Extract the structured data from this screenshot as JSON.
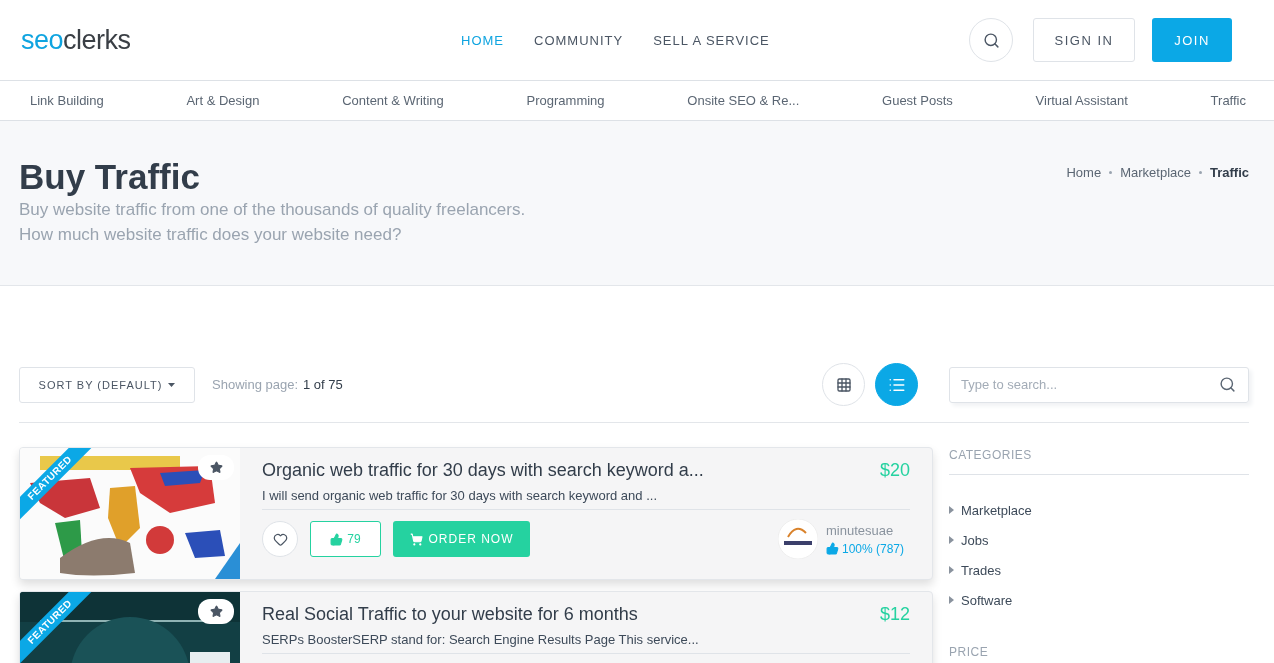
{
  "header": {
    "logo": {
      "part_1": "seo",
      "part_2": "clerks"
    },
    "nav": [
      {
        "label": "HOME",
        "selected": true
      },
      {
        "label": "COMMUNITY",
        "selected": false
      },
      {
        "label": "SELL A SERVICE",
        "selected": false
      }
    ],
    "sign_in": "SIGN IN",
    "join": "JOIN"
  },
  "category_bar": [
    "Link Building",
    "Art & Design",
    "Content & Writing",
    "Programming",
    "Onsite SEO & Re...",
    "Guest Posts",
    "Virtual Assistant",
    "Traffic"
  ],
  "hero": {
    "title": "Buy Traffic",
    "subtitle_lines": [
      "Buy website traffic from one of the thousands of quality freelancers.",
      "How much website traffic does your website need?"
    ],
    "breadcrumb": [
      {
        "label": "Home",
        "current": false
      },
      {
        "label": "Marketplace",
        "current": false
      },
      {
        "label": "Traffic",
        "current": true
      }
    ]
  },
  "toolbar": {
    "sort": "SORT BY (DEFAULT)",
    "showing_label": "Showing page:",
    "showing_value": "1 of 75",
    "view_toggle": [
      {
        "kind": "grid",
        "selected": false
      },
      {
        "kind": "list",
        "selected": true
      }
    ],
    "search": {
      "placeholder": "Type to search..."
    }
  },
  "listings": [
    {
      "badge": "FEATURED",
      "title": "Organic web traffic for 30 days with search keyword a...",
      "price": "$20",
      "description": "I will send organic web traffic for 30 days with search keyword and ...",
      "likes": "79",
      "order": "ORDER NOW",
      "seller": "minutesuae",
      "rating": "100% (787)"
    },
    {
      "badge": "FEATURED",
      "title": "Real Social Traffic to your website for 6 months",
      "price": "$12",
      "description": "SERPs BoosterSERP stand for: Search Engine Results Page This service..."
    }
  ],
  "sidebar": {
    "categories_heading": "CATEGORIES",
    "categories": [
      "Marketplace",
      "Jobs",
      "Trades",
      "Software"
    ],
    "price_heading": "PRICE"
  }
}
